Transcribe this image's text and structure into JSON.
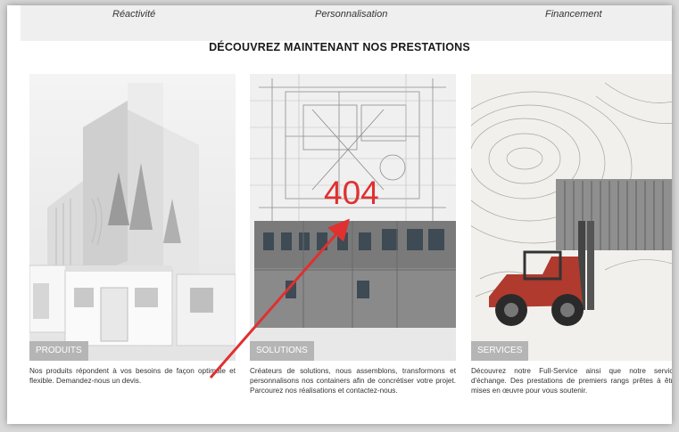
{
  "topbar": {
    "items": [
      "Réactivité",
      "Personnalisation",
      "Financement"
    ]
  },
  "section": {
    "title": "DÉCOUVREZ MAINTENANT NOS PRESTATIONS"
  },
  "cards": [
    {
      "badge": "PRODUITS",
      "text": "Nos produits répondent à vos besoins de façon optimale et flexible. Demandez-nous un devis."
    },
    {
      "badge": "SOLUTIONS",
      "text": "Créateurs de solutions, nous assemblons, transformons et personnalisons nos containers afin de concrétiser votre projet. Parcourez nos réalisations et contactez-nous."
    },
    {
      "badge": "SERVICES",
      "text": "Découvrez notre Full-Service ainsi que notre service d'échange. Des prestations de premiers rangs prêtes à être mises en œuvre pour vous soutenir."
    }
  ],
  "annotation": {
    "error_text": "404",
    "color": "#e03030"
  },
  "colors": {
    "badge_bg": "#b5b5b5",
    "topbar_bg": "#efefef"
  }
}
